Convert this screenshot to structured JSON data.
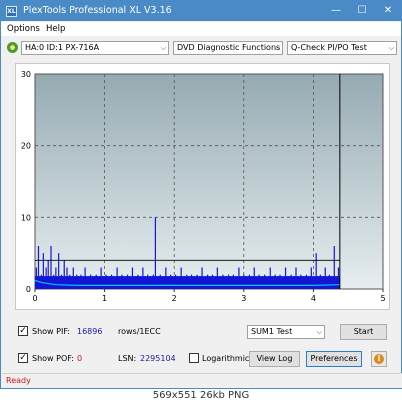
{
  "window": {
    "title": "PlexTools Professional XL V3.16",
    "icon_text": "XL"
  },
  "menu": {
    "options": "Options",
    "help": "Help"
  },
  "toolbar": {
    "drive": "HA:0 ID:1  PX-716A",
    "function": "DVD Diagnostic Functions",
    "test": "Q-Check PI/PO Test"
  },
  "chart_data": {
    "type": "bar",
    "x_ticks": [
      "0",
      "1",
      "2",
      "3",
      "4",
      "5"
    ],
    "y_ticks": [
      "0",
      "10",
      "20",
      "30"
    ],
    "xlim": [
      0,
      5
    ],
    "ylim": [
      0,
      30
    ],
    "grid": true,
    "end_marker_x": 4.38,
    "threshold_y": 4,
    "pif_series": {
      "x": [
        0.02,
        0.05,
        0.09,
        0.12,
        0.16,
        0.19,
        0.23,
        0.27,
        0.3,
        0.34,
        0.38,
        0.42,
        0.46,
        0.5,
        0.55,
        0.6,
        0.66,
        0.72,
        0.8,
        0.88,
        0.95,
        1.02,
        1.1,
        1.18,
        1.25,
        1.33,
        1.4,
        1.48,
        1.55,
        1.62,
        1.7,
        1.73,
        1.8,
        1.88,
        1.95,
        2.02,
        2.1,
        2.18,
        2.25,
        2.33,
        2.4,
        2.48,
        2.55,
        2.62,
        2.7,
        2.78,
        2.85,
        2.93,
        3.0,
        3.08,
        3.15,
        3.22,
        3.3,
        3.38,
        3.45,
        3.52,
        3.6,
        3.68,
        3.75,
        3.82,
        3.9,
        3.97,
        4.04,
        4.1,
        4.17,
        4.23,
        4.3,
        4.36
      ],
      "y": [
        3,
        6,
        2,
        5,
        3,
        4,
        6,
        2,
        3,
        5,
        2,
        4,
        3,
        2,
        3,
        2,
        2,
        3,
        2,
        2,
        3,
        2,
        2,
        3,
        2,
        2,
        3,
        2,
        3,
        2,
        2,
        10,
        2,
        3,
        2,
        2,
        3,
        2,
        2,
        2,
        3,
        2,
        2,
        3,
        2,
        2,
        2,
        3,
        2,
        2,
        3,
        2,
        2,
        3,
        2,
        2,
        3,
        2,
        3,
        2,
        2,
        3,
        5,
        2,
        3,
        2,
        6,
        3
      ]
    },
    "po_series": {
      "x": [
        0,
        0.1,
        0.3,
        0.6,
        1.0,
        1.5,
        2.0,
        2.5,
        3.0,
        3.5,
        4.0,
        4.38
      ],
      "y": [
        1.2,
        0.9,
        0.6,
        0.5,
        0.5,
        0.5,
        0.5,
        0.5,
        0.5,
        0.5,
        0.5,
        0.6
      ]
    }
  },
  "stats": {
    "show_pif_label": "Show PIF:",
    "pif_value": "16896",
    "rows_unit": "rows/1ECC",
    "show_pof_label": "Show POF:",
    "pof_value": "0",
    "lsn_label": "LSN:",
    "lsn_value": "2295104",
    "logarithmic_label": "Logarithmic",
    "sum_select": "SUM1 Test"
  },
  "buttons": {
    "start": "Start",
    "view_log": "View Log",
    "preferences": "Preferences",
    "info": "i"
  },
  "status": {
    "text": "Ready"
  },
  "caption": {
    "text": "569x551  26kb  PNG"
  },
  "colors": {
    "title_bar": "#4a8bc7",
    "pif_bars": "#1515d8",
    "po_line": "#00c8e0",
    "plot_bg_top": "#96aab2",
    "plot_bg_bottom": "#e6eef0",
    "status_text": "#d01818"
  }
}
